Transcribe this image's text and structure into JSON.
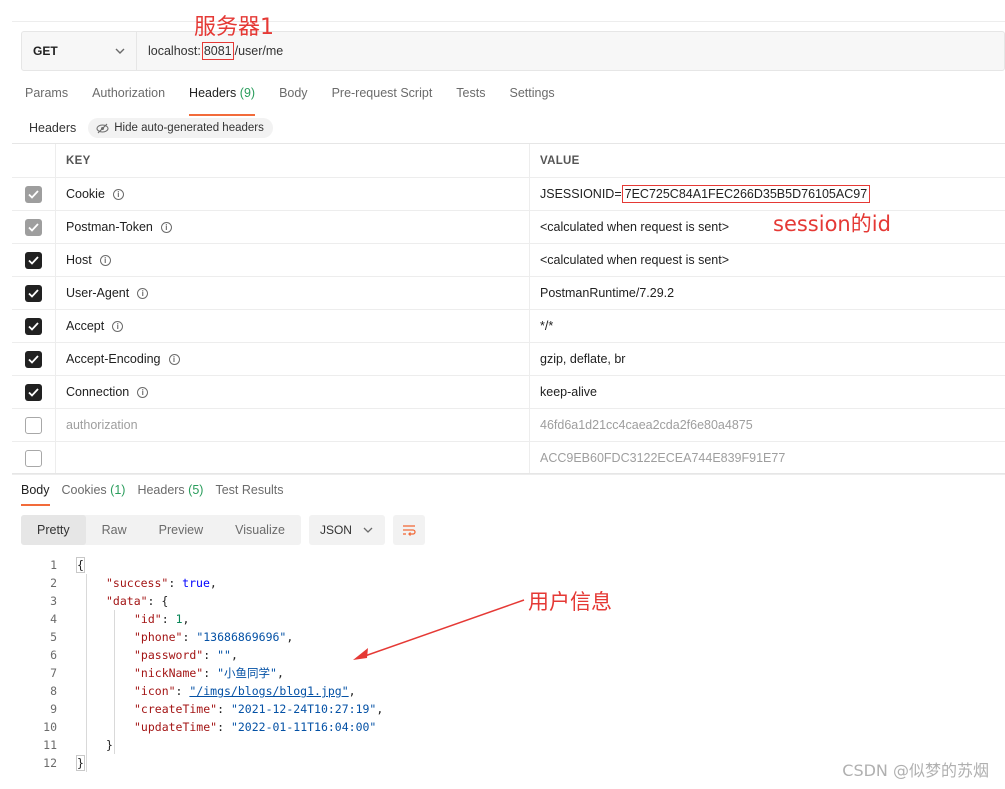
{
  "request": {
    "method": "GET",
    "url_prefix": "localhost:",
    "url_port": "8081",
    "url_path": "/user/me"
  },
  "request_tabs": [
    {
      "label": "Params"
    },
    {
      "label": "Authorization"
    },
    {
      "label": "Headers",
      "count": "(9)",
      "active": true
    },
    {
      "label": "Body"
    },
    {
      "label": "Pre-request Script"
    },
    {
      "label": "Tests"
    },
    {
      "label": "Settings"
    }
  ],
  "headers_section": {
    "label": "Headers",
    "hide_button": "Hide auto-generated headers"
  },
  "table": {
    "key_header": "KEY",
    "value_header": "VALUE",
    "rows": [
      {
        "key": "Cookie",
        "value_prefix": "JSESSIONID=",
        "value": "7EC725C84A1FEC266D35B5D76105AC97",
        "state": "grey",
        "info": true
      },
      {
        "key": "Postman-Token",
        "value": "<calculated when request is sent>",
        "state": "grey",
        "info": true
      },
      {
        "key": "Host",
        "value": "<calculated when request is sent>",
        "state": "on",
        "info": true
      },
      {
        "key": "User-Agent",
        "value": "PostmanRuntime/7.29.2",
        "state": "on",
        "info": true
      },
      {
        "key": "Accept",
        "value": "*/*",
        "state": "on",
        "info": true
      },
      {
        "key": "Accept-Encoding",
        "value": "gzip, deflate, br",
        "state": "on",
        "info": true
      },
      {
        "key": "Connection",
        "value": "keep-alive",
        "state": "on",
        "info": true
      },
      {
        "key": "authorization",
        "value": "46fd6a1d21cc4caea2cda2f6e80a4875",
        "state": "off",
        "info": false
      },
      {
        "key": "",
        "value": "ACC9EB60FDC3122ECEA744E839F91E77",
        "state": "off",
        "info": false
      }
    ]
  },
  "response_tabs": [
    {
      "label": "Body",
      "active": true
    },
    {
      "label": "Cookies",
      "count": "(1)"
    },
    {
      "label": "Headers",
      "count": "(5)"
    },
    {
      "label": "Test Results"
    }
  ],
  "response_toolbar": {
    "views": [
      "Pretty",
      "Raw",
      "Preview",
      "Visualize"
    ],
    "active_view": "Pretty",
    "format": "JSON"
  },
  "code_lines": [
    {
      "n": "1",
      "text": "{"
    },
    {
      "n": "2",
      "text": "\"success\": true,"
    },
    {
      "n": "3",
      "text": "\"data\": {"
    },
    {
      "n": "4",
      "text": "\"id\": 1,"
    },
    {
      "n": "5",
      "text": "\"phone\": \"13686869696\","
    },
    {
      "n": "6",
      "text": "\"password\": \"\","
    },
    {
      "n": "7",
      "text": "\"nickName\": \"小鱼同学\","
    },
    {
      "n": "8",
      "text": "\"icon\": \"/imgs/blogs/blog1.jpg\","
    },
    {
      "n": "9",
      "text": "\"createTime\": \"2021-12-24T10:27:19\","
    },
    {
      "n": "10",
      "text": "\"updateTime\": \"2022-01-11T16:04:00\""
    },
    {
      "n": "11",
      "text": "}"
    },
    {
      "n": "12",
      "text": "}"
    }
  ],
  "annotations": {
    "server": "服务器1",
    "session": "session的id",
    "user_info": "用户信息"
  },
  "watermark": "CSDN @似梦的苏烟",
  "colors": {
    "accent": "#f26b3a",
    "annotation": "#e53935",
    "count_green": "#2a9d5c"
  }
}
